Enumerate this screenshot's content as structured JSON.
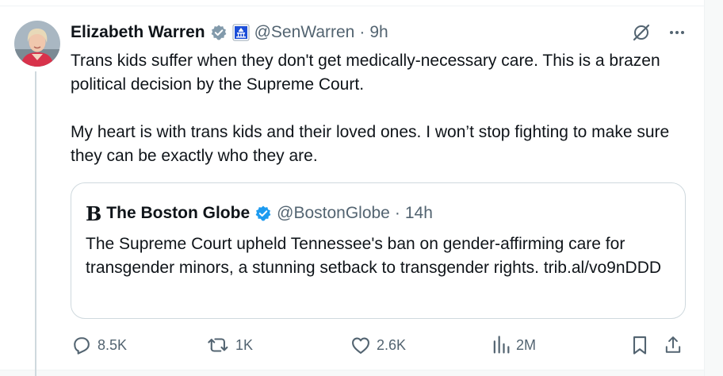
{
  "tweet": {
    "author_name": "Elizabeth Warren",
    "handle": "@SenWarren",
    "separator": "·",
    "time": "9h",
    "verified": true,
    "affiliation_icon": "us-capitol-icon",
    "paragraphs": [
      "Trans kids suffer when they don't get medically-necessary care. This is a brazen political decision by the Supreme Court.",
      "My heart is with trans kids and their loved ones. I won’t stop fighting to make sure they can be exactly who they are."
    ],
    "colors": {
      "verified_badge": "#829aab",
      "capitol_badge": "#1d4fd8",
      "text": "#0f1419",
      "secondary": "#536471",
      "border": "#cfd9de"
    }
  },
  "quote": {
    "logo": "B",
    "author_name": "The Boston Globe",
    "handle": "@BostonGlobe",
    "separator": "·",
    "time": "14h",
    "verified": true,
    "text": "The Supreme Court upheld Tennessee's ban on gender-affirming care for transgender minors, a stunning setback to transgender rights. trib.al/vo9nDDD",
    "colors": {
      "verified_badge": "#1d9bf0"
    }
  },
  "actions": {
    "replies": "8.5K",
    "reposts": "1K",
    "likes": "2.6K",
    "views": "2M"
  }
}
